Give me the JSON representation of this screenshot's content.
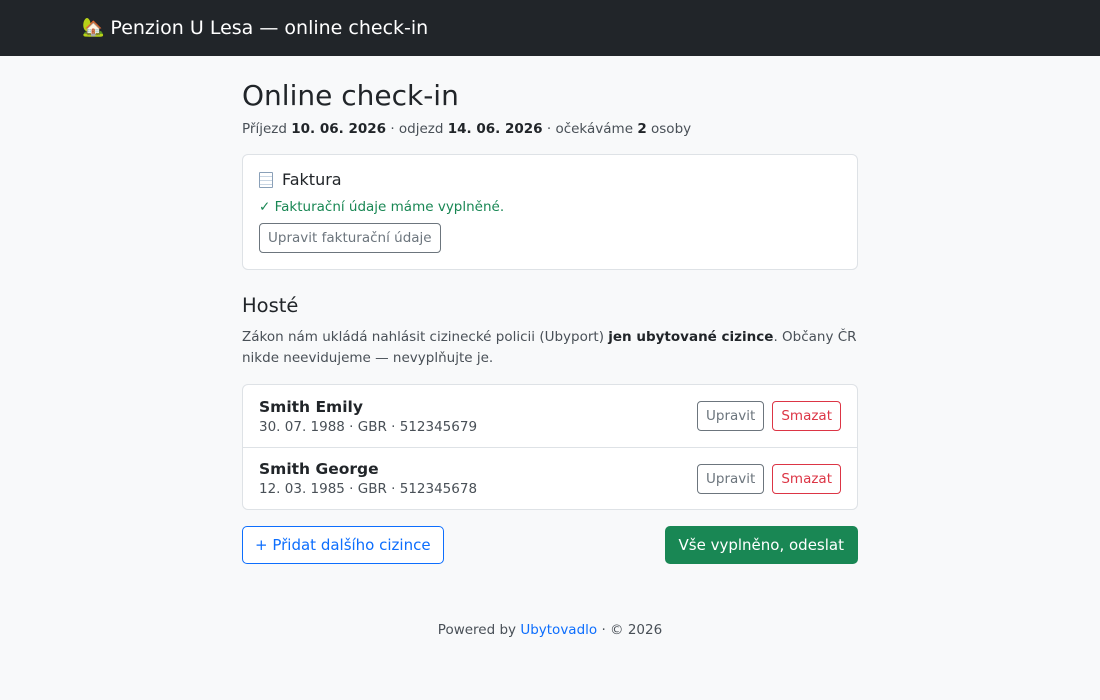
{
  "navbar": {
    "brand_icon": "🏡",
    "brand": "Penzion U Lesa — online check-in"
  },
  "page": {
    "title": "Online check-in",
    "meta": {
      "arrival_label": "Příjezd",
      "arrival": "10. 06. 2026",
      "departure_label": "· odjezd",
      "departure": "14. 06. 2026",
      "expected_label": "· očekáváme",
      "count": "2",
      "count_suffix": "osoby"
    }
  },
  "invoice": {
    "icon": "receipt-icon",
    "title": "Faktura",
    "status": "✓ Fakturační údaje máme vyplněné.",
    "edit_label": "Upravit fakturační údaje"
  },
  "guests": {
    "title": "Hosté",
    "law_before": "Zákon nám ukládá nahlásit cizinecké policii (Ubyport) ",
    "law_bold": "jen ubytované cizince",
    "law_after": ". Občany ČR nikde neevidujeme — nevyplňujte je.",
    "items": [
      {
        "name": "Smith Emily",
        "info": "30. 07. 1988 · GBR · 512345679",
        "edit": "Upravit",
        "delete": "Smazat"
      },
      {
        "name": "Smith George",
        "info": "12. 03. 1985 · GBR · 512345678",
        "edit": "Upravit",
        "delete": "Smazat"
      }
    ],
    "add_label": "+ Přidat dalšího cizince",
    "submit_label": "Vše vyplněno, odeslat"
  },
  "footer": {
    "prefix": "Powered by",
    "link": "Ubytovadlo",
    "suffix": "· © 2026"
  },
  "colors": {
    "navbar": "#212529",
    "success": "#198754",
    "primary": "#0d6efd",
    "danger": "#dc3545",
    "background": "#f8f9fa"
  }
}
